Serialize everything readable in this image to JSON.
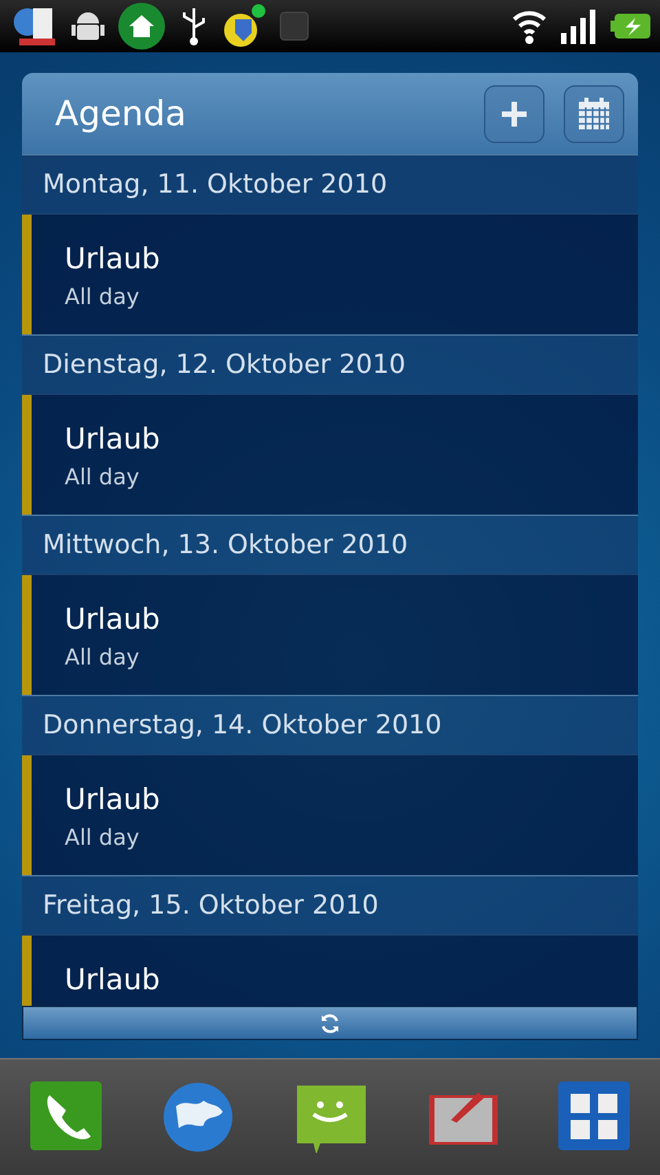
{
  "widget": {
    "title": "Agenda"
  },
  "days": [
    {
      "date": "Montag, 11. Oktober 2010",
      "events": [
        {
          "title": "Urlaub",
          "time": "All day",
          "color": "#b8960c"
        }
      ]
    },
    {
      "date": "Dienstag, 12. Oktober 2010",
      "events": [
        {
          "title": "Urlaub",
          "time": "All day",
          "color": "#b8960c"
        }
      ]
    },
    {
      "date": "Mittwoch, 13. Oktober 2010",
      "events": [
        {
          "title": "Urlaub",
          "time": "All day",
          "color": "#b8960c"
        }
      ]
    },
    {
      "date": "Donnerstag, 14. Oktober 2010",
      "events": [
        {
          "title": "Urlaub",
          "time": "All day",
          "color": "#b8960c"
        }
      ]
    },
    {
      "date": "Freitag, 15. Oktober 2010",
      "events": [
        {
          "title": "Urlaub",
          "color": "#b8960c"
        }
      ]
    }
  ]
}
